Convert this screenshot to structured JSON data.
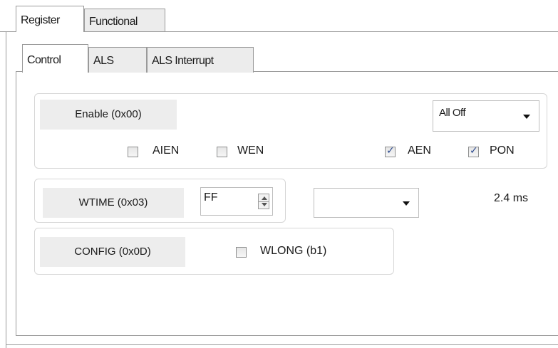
{
  "tabs": {
    "outer": [
      "Register",
      "Functional"
    ],
    "inner": [
      "Control",
      "ALS",
      "ALS Interrupt"
    ]
  },
  "enable": {
    "label": "Enable (0x00)",
    "preset": "All Off",
    "checkboxes": [
      {
        "label": "AIEN",
        "checked": false
      },
      {
        "label": "WEN",
        "checked": false
      },
      {
        "label": "AEN",
        "checked": true
      },
      {
        "label": "PON",
        "checked": true
      }
    ]
  },
  "wtime": {
    "label": "WTIME (0x03)",
    "value": "FF",
    "select_value": "",
    "time_text": "2.4 ms"
  },
  "config": {
    "label": "CONFIG (0x0D)",
    "checkbox": {
      "label": "WLONG (b1)",
      "checked": false
    }
  },
  "colors": {
    "checkmark": "#2c4a8f",
    "tab_border": "#9a9a9a",
    "label_bg": "#ededed"
  }
}
